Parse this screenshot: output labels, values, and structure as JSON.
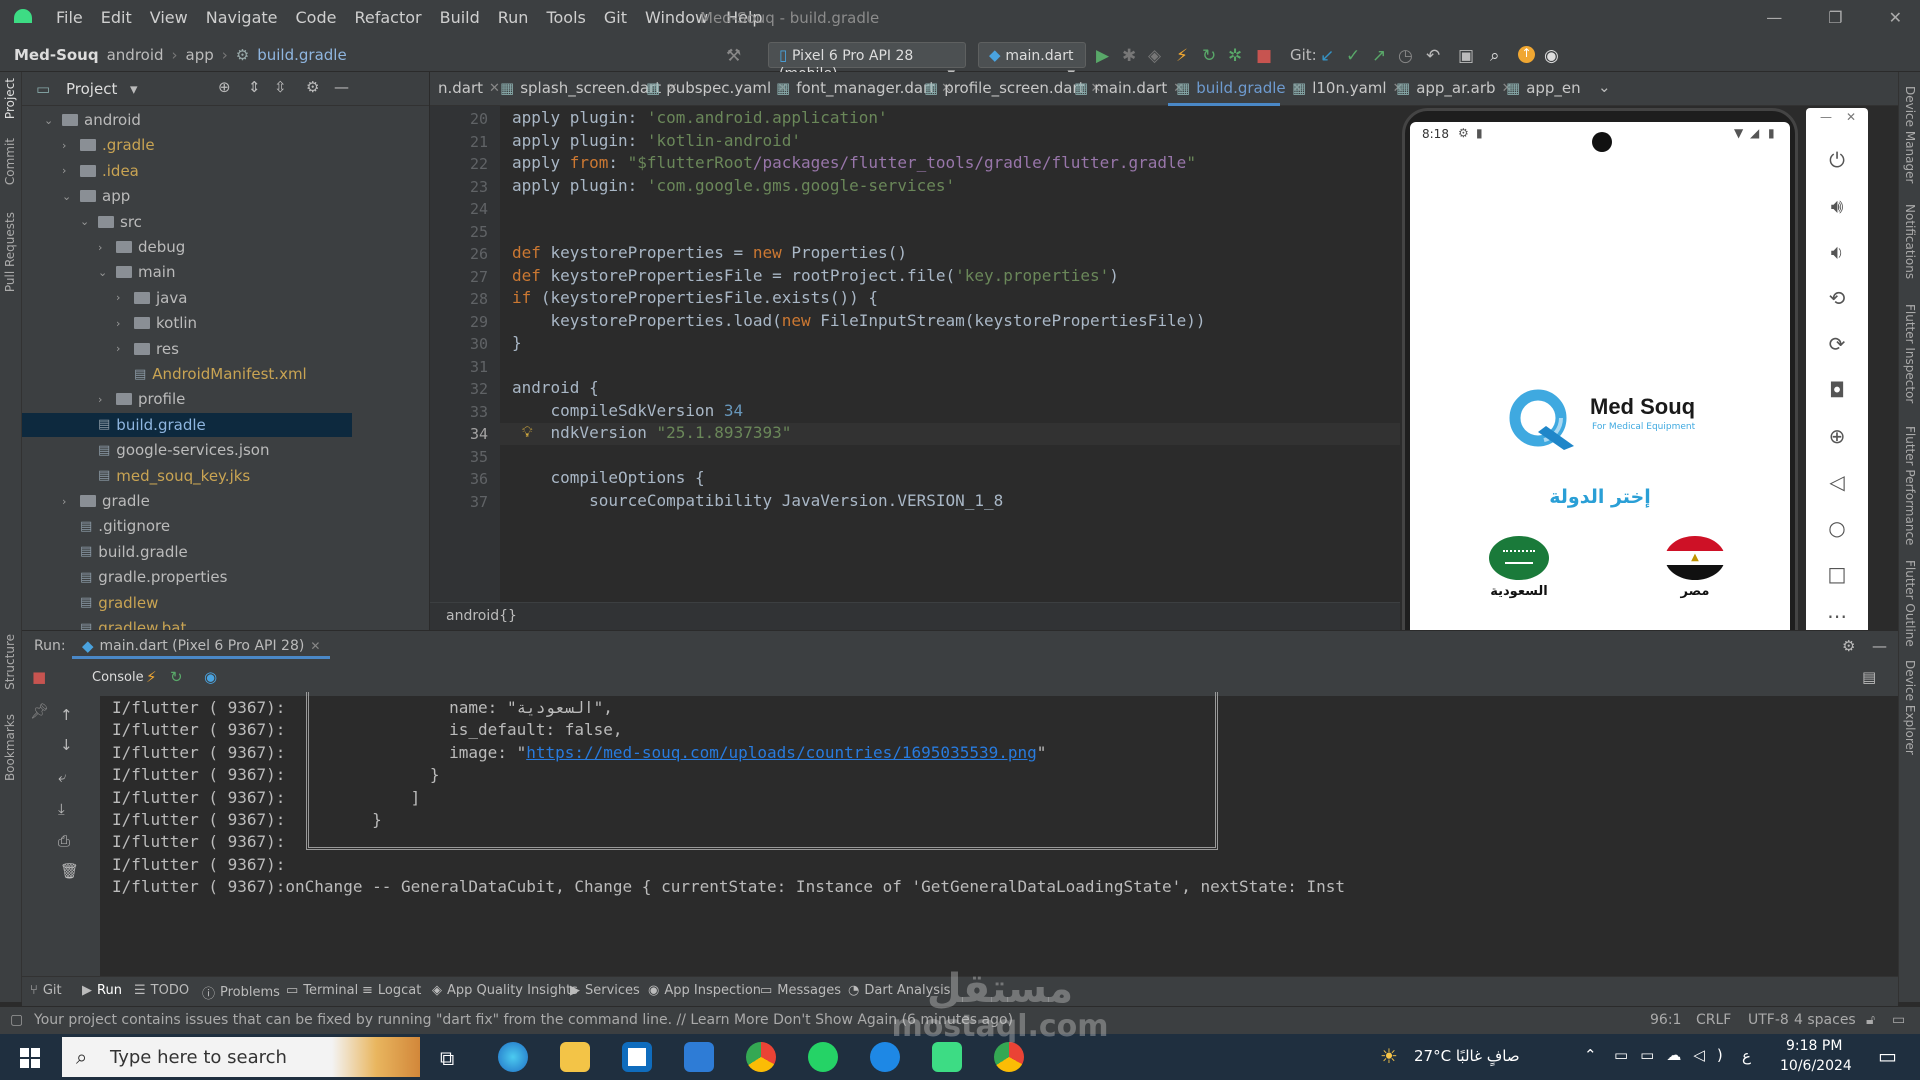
{
  "app": {
    "window_title": "Med-Souq - build.gradle",
    "menu": [
      "File",
      "Edit",
      "View",
      "Navigate",
      "Code",
      "Refactor",
      "Build",
      "Run",
      "Tools",
      "Git",
      "Window",
      "Help"
    ]
  },
  "navbar": {
    "breadcrumbs": [
      "Med-Souq",
      "android",
      "app",
      "build.gradle"
    ],
    "device": "Pixel 6 Pro API 28 (mobile)",
    "run_config": "main.dart",
    "git_label": "Git:"
  },
  "project": {
    "title": "Project",
    "tree": [
      {
        "label": "android",
        "depth": 0,
        "open": true,
        "type": "folder"
      },
      {
        "label": ".gradle",
        "depth": 1,
        "open": false,
        "type": "folder",
        "color": "gold"
      },
      {
        "label": ".idea",
        "depth": 1,
        "open": false,
        "type": "folder",
        "color": "gold"
      },
      {
        "label": "app",
        "depth": 1,
        "open": true,
        "type": "folder"
      },
      {
        "label": "src",
        "depth": 2,
        "open": true,
        "type": "folder"
      },
      {
        "label": "debug",
        "depth": 3,
        "open": false,
        "type": "folder"
      },
      {
        "label": "main",
        "depth": 3,
        "open": true,
        "type": "folder"
      },
      {
        "label": "java",
        "depth": 4,
        "open": false,
        "type": "folder"
      },
      {
        "label": "kotlin",
        "depth": 4,
        "open": false,
        "type": "folder"
      },
      {
        "label": "res",
        "depth": 4,
        "open": false,
        "type": "folder"
      },
      {
        "label": "AndroidManifest.xml",
        "depth": 4,
        "type": "file",
        "color": "gold"
      },
      {
        "label": "profile",
        "depth": 3,
        "open": false,
        "type": "folder"
      },
      {
        "label": "build.gradle",
        "depth": 2,
        "type": "file",
        "selected": true,
        "color": "blue"
      },
      {
        "label": "google-services.json",
        "depth": 2,
        "type": "file"
      },
      {
        "label": "med_souq_key.jks",
        "depth": 2,
        "type": "file",
        "color": "gold"
      },
      {
        "label": "gradle",
        "depth": 1,
        "open": false,
        "type": "folder"
      },
      {
        "label": ".gitignore",
        "depth": 1,
        "type": "file"
      },
      {
        "label": "build.gradle",
        "depth": 1,
        "type": "file"
      },
      {
        "label": "gradle.properties",
        "depth": 1,
        "type": "file"
      },
      {
        "label": "gradlew",
        "depth": 1,
        "type": "file",
        "color": "gold"
      },
      {
        "label": "gradlew.bat",
        "depth": 1,
        "type": "file",
        "color": "gold"
      }
    ]
  },
  "tabs": [
    {
      "label": "n.dart"
    },
    {
      "label": "splash_screen.dart"
    },
    {
      "label": "pubspec.yaml"
    },
    {
      "label": "font_manager.dart"
    },
    {
      "label": "profile_screen.dart"
    },
    {
      "label": "main.dart"
    },
    {
      "label": "build.gradle",
      "active": true
    },
    {
      "label": "l10n.yaml"
    },
    {
      "label": "app_ar.arb"
    },
    {
      "label": "app_en"
    }
  ],
  "editor": {
    "line_numbers": [
      "20",
      "21",
      "22",
      "23",
      "24",
      "25",
      "26",
      "27",
      "28",
      "29",
      "30",
      "31",
      "32",
      "33",
      "34",
      "35",
      "36",
      "37"
    ],
    "lines": [
      [
        [
          "kw0",
          "apply plugin: "
        ],
        [
          "st",
          "'com.android.application'"
        ]
      ],
      [
        [
          "kw0",
          "apply plugin: "
        ],
        [
          "st",
          "'kotlin-android'"
        ]
      ],
      [
        [
          "kw0",
          "apply "
        ],
        [
          "kw",
          "from"
        ],
        [
          "kw0",
          ": "
        ],
        [
          "st",
          "\"$flutterRoot"
        ],
        [
          "pu",
          "/packages/flutter_tools/gradle/flutter.gradle"
        ],
        [
          "st",
          "\""
        ]
      ],
      [
        [
          "kw0",
          "apply plugin: "
        ],
        [
          "st",
          "'com.google.gms.google-services'"
        ]
      ],
      [],
      [],
      [
        [
          "kw",
          "def "
        ],
        [
          "kw0",
          "keystoreProperties = "
        ],
        [
          "kw",
          "new "
        ],
        [
          "kw0",
          "Properties()"
        ]
      ],
      [
        [
          "kw",
          "def "
        ],
        [
          "kw0",
          "keystorePropertiesFile = rootProject.file("
        ],
        [
          "st",
          "'key.properties'"
        ],
        [
          "kw0",
          ")"
        ]
      ],
      [
        [
          "kw",
          "if "
        ],
        [
          "kw0",
          "(keystorePropertiesFile.exists()) {"
        ]
      ],
      [
        [
          "kw0",
          "    keystoreProperties.load("
        ],
        [
          "kw",
          "new "
        ],
        [
          "kw0",
          "FileInputStream(keystorePropertiesFile))"
        ]
      ],
      [
        [
          "kw0",
          "}"
        ]
      ],
      [],
      [
        [
          "kw0",
          "android {"
        ]
      ],
      [
        [
          "kw0",
          "    compileSdkVersion "
        ],
        [
          "nu",
          "34"
        ]
      ],
      [
        [
          "kw0",
          "    ndkVersion "
        ],
        [
          "st",
          "\"25.1.8937393\""
        ]
      ],
      [],
      [
        [
          "kw0",
          "    compileOptions {"
        ]
      ],
      [
        [
          "kw0",
          "        sourceCompatibility JavaVersion.VERSION_1_8"
        ]
      ]
    ],
    "breadcrumb": "android{}"
  },
  "run": {
    "label": "Run:",
    "tab": "main.dart (Pixel 6 Pro API 28)",
    "console_tab": "Console",
    "prefix": "I/flutter ( 9367):",
    "lines": [
      "                 name: \"السعودية\",",
      "                 is_default: false,",
      "                 image: \"",
      "               }",
      "             ]",
      "         }",
      "",
      "",
      "onChange -- GeneralDataCubit, Change { currentState: Instance of 'GetGeneralDataLoadingState', nextState: Inst"
    ],
    "link": "https://med-souq.com/uploads/countries/1695035539.png"
  },
  "bottom_tools": [
    "Git",
    "Run",
    "TODO",
    "Problems",
    "Terminal",
    "Logcat",
    "App Quality Insights",
    "Services",
    "App Inspection",
    "Messages",
    "Dart Analysis"
  ],
  "status": {
    "message": "Your project contains issues that can be fixed by running \"dart fix\" from the command line. // Learn More  Don't Show Again (6 minutes ago)",
    "position": "96:1",
    "line_sep": "CRLF",
    "encoding": "UTF-8",
    "indent": "4 spaces"
  },
  "side_labels_left": [
    "Project",
    "Commit",
    "Pull Requests",
    "Structure",
    "Bookmarks"
  ],
  "side_labels_right": [
    "Device Manager",
    "Notifications",
    "Flutter Inspector",
    "Flutter Performance",
    "Flutter Outline",
    "Device Explorer"
  ],
  "phone": {
    "time": "8:18",
    "brand": "Med Souq",
    "tagline": "For Medical Equipment",
    "heading": "إختر الدولة",
    "countries": [
      {
        "name": "السعودية",
        "flag": "saudi"
      },
      {
        "name": "مصر",
        "flag": "egypt"
      }
    ]
  },
  "taskbar": {
    "search_placeholder": "Type here to search",
    "weather": "27°C صافٍ غالبًا",
    "lang": "ع",
    "time": "9:18 PM",
    "date": "10/6/2024"
  },
  "watermark": {
    "ar": "مستقل",
    "en": "mostaql.com"
  },
  "colors": {
    "accent": "#3592c4",
    "brand_blue": "#2a9fd6",
    "ide_bg": "#2b2b2b"
  }
}
